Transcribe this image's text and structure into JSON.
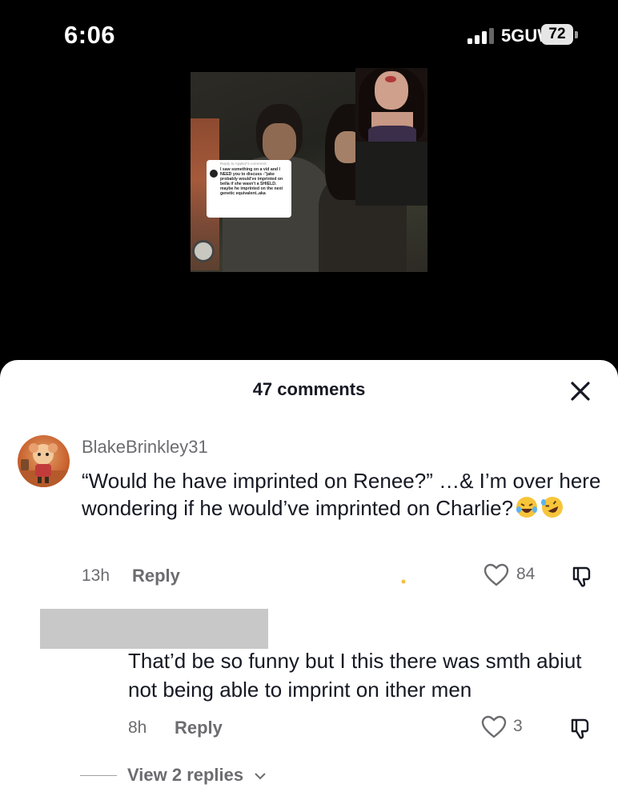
{
  "status_bar": {
    "time": "6:06",
    "network": "5GUW",
    "battery": "72"
  },
  "video": {
    "reply_card": {
      "header": "Reply to Applez's comment",
      "body": "I saw something on a vid and I NEED you to discuss -\"jake probably would've imprinted on bella if she wasn't a SHIELD. maybe he imprinted on the next genetic equivalent..aka"
    }
  },
  "comments_sheet": {
    "title": "47 comments",
    "comments": [
      {
        "username": "BlakeBrinkley31",
        "text": "“Would he have imprinted on Renee?” …& I’m over here wondering if he would’ve imprinted on Charlie?",
        "time": "13h",
        "reply_label": "Reply",
        "likes": "84"
      }
    ],
    "reply": {
      "text": "That’d be so funny but I this there was smth abiut not being able to imprint on ither men",
      "time": "8h",
      "reply_label": "Reply",
      "likes": "3"
    },
    "view_replies": "View 2 replies"
  },
  "colors": {
    "text_primary": "#161823",
    "text_secondary": "#6c6c70",
    "sheet_bg": "#ffffff",
    "app_bg": "#000000"
  },
  "icons": [
    "signal-icon",
    "battery-icon",
    "close-icon",
    "heart-icon",
    "dislike-icon",
    "chevron-down-icon",
    "laughing-emoji",
    "rofl-emoji"
  ]
}
